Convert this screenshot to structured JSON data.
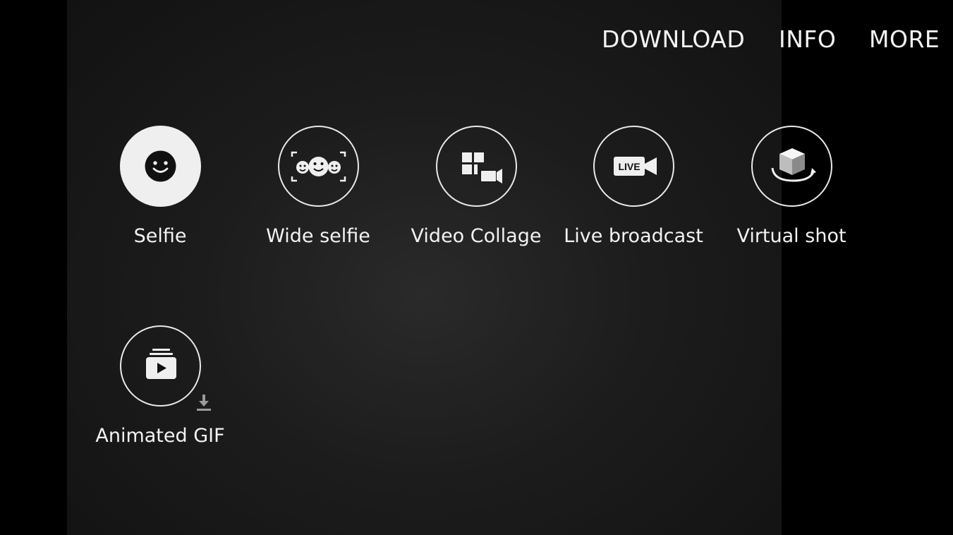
{
  "top_bar": {
    "download": "DOWNLOAD",
    "info": "INFO",
    "more": "MORE"
  },
  "modes": [
    {
      "label": "Selfie",
      "icon": "smiley-face-icon",
      "selected": true
    },
    {
      "label": "Wide selfie",
      "icon": "wide-selfie-faces-icon",
      "selected": false
    },
    {
      "label": "Video Collage",
      "icon": "video-collage-icon",
      "selected": false
    },
    {
      "label": "Live broadcast",
      "icon": "live-camera-icon",
      "selected": false
    },
    {
      "label": "Virtual shot",
      "icon": "rotating-cube-icon",
      "selected": false
    },
    {
      "label": "Animated GIF",
      "icon": "stacked-play-icon",
      "selected": false,
      "badge_icon": "download-arrow-icon"
    }
  ],
  "live_badge_text": "LIVE",
  "colors": {
    "background": "#000000",
    "viewport": "#1c1c1c",
    "icon_white": "#efefef",
    "text": "#f2f2f2"
  }
}
